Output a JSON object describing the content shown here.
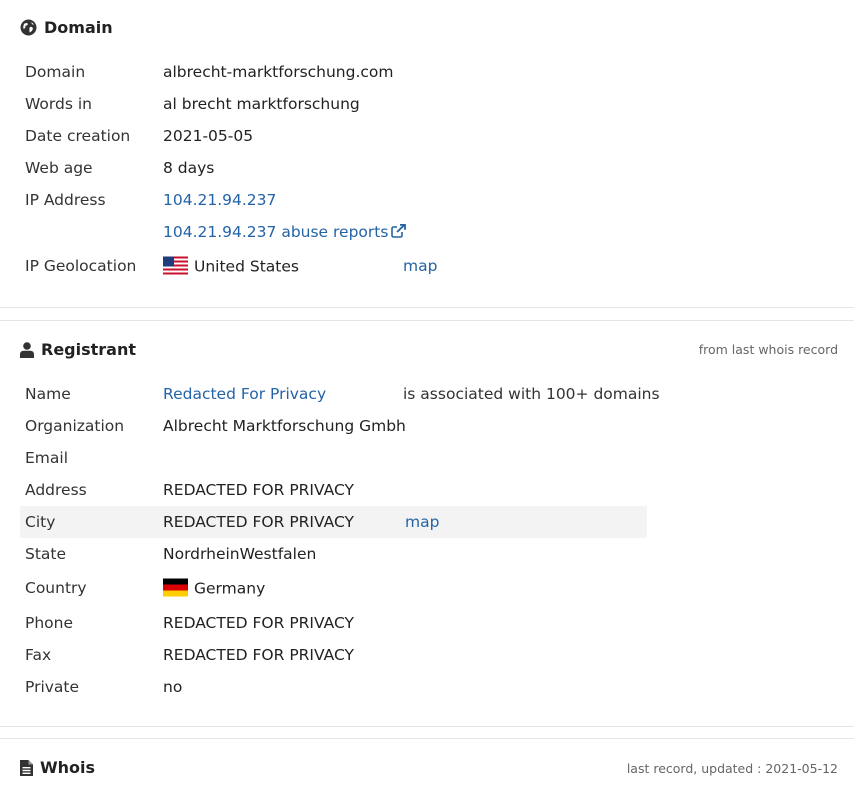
{
  "domain_section": {
    "title": "Domain",
    "rows": [
      {
        "label": "Domain",
        "value": "albrecht-marktforschung.com"
      },
      {
        "label": "Words in",
        "value": "al brecht marktforschung"
      },
      {
        "label": "Date creation",
        "value": "2021-05-05"
      },
      {
        "label": "Web age",
        "value": "8 days"
      },
      {
        "label": "IP Address",
        "value": "104.21.94.237"
      }
    ],
    "abuse_link": "104.21.94.237 abuse reports",
    "geolocation": {
      "label": "IP Geolocation",
      "country": "United States",
      "map_link": "map"
    }
  },
  "registrant_section": {
    "title": "Registrant",
    "note": "from last whois record",
    "name": {
      "label": "Name",
      "value": "Redacted For Privacy",
      "extra": "is associated with 100+ domains"
    },
    "organization": {
      "label": "Organization",
      "value": "Albrecht Marktforschung Gmbh"
    },
    "email": {
      "label": "Email",
      "value": ""
    },
    "address": {
      "label": "Address",
      "value": "REDACTED FOR PRIVACY"
    },
    "city": {
      "label": "City",
      "value": "REDACTED FOR PRIVACY",
      "map_link": "map"
    },
    "state": {
      "label": "State",
      "value": "NordrheinWestfalen"
    },
    "country": {
      "label": "Country",
      "value": "Germany"
    },
    "phone": {
      "label": "Phone",
      "value": "REDACTED FOR PRIVACY"
    },
    "fax": {
      "label": "Fax",
      "value": "REDACTED FOR PRIVACY"
    },
    "private": {
      "label": "Private",
      "value": "no"
    }
  },
  "whois_section": {
    "title": "Whois",
    "note": "last record, updated : 2021-05-12"
  },
  "colors": {
    "link": "#2463a6",
    "highlight_row": "#f3f3f3",
    "divider": "#e6e6e6"
  },
  "icons": [
    "globe-icon",
    "external-link-icon",
    "us-flag-icon",
    "user-icon",
    "de-flag-icon",
    "document-icon"
  ]
}
